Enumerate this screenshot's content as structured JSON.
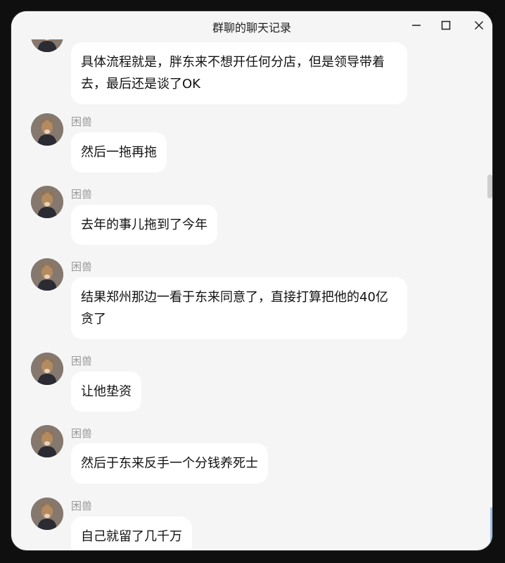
{
  "window": {
    "title": "群聊的聊天记录",
    "controls": [
      "minimize-icon",
      "maximize-icon",
      "close-icon"
    ]
  },
  "messages": [
    {
      "sender": "",
      "text": "具体流程就是，胖东来不想开任何分店，但是领导带着去，最后还是谈了OK"
    },
    {
      "sender": "困兽",
      "text": "然后一拖再拖"
    },
    {
      "sender": "困兽",
      "text": "去年的事儿拖到了今年"
    },
    {
      "sender": "困兽",
      "text": "结果郑州那边一看于东来同意了，直接打算把他的40亿贪了"
    },
    {
      "sender": "困兽",
      "text": "让他垫资"
    },
    {
      "sender": "困兽",
      "text": "然后于东来反手一个分钱养死士"
    },
    {
      "sender": "困兽",
      "text": "自己就留了几千万"
    }
  ],
  "colors": {
    "background": "#f5f5f5",
    "bubble": "#ffffff",
    "sender_name": "#9a9a9a",
    "text": "#111111"
  }
}
